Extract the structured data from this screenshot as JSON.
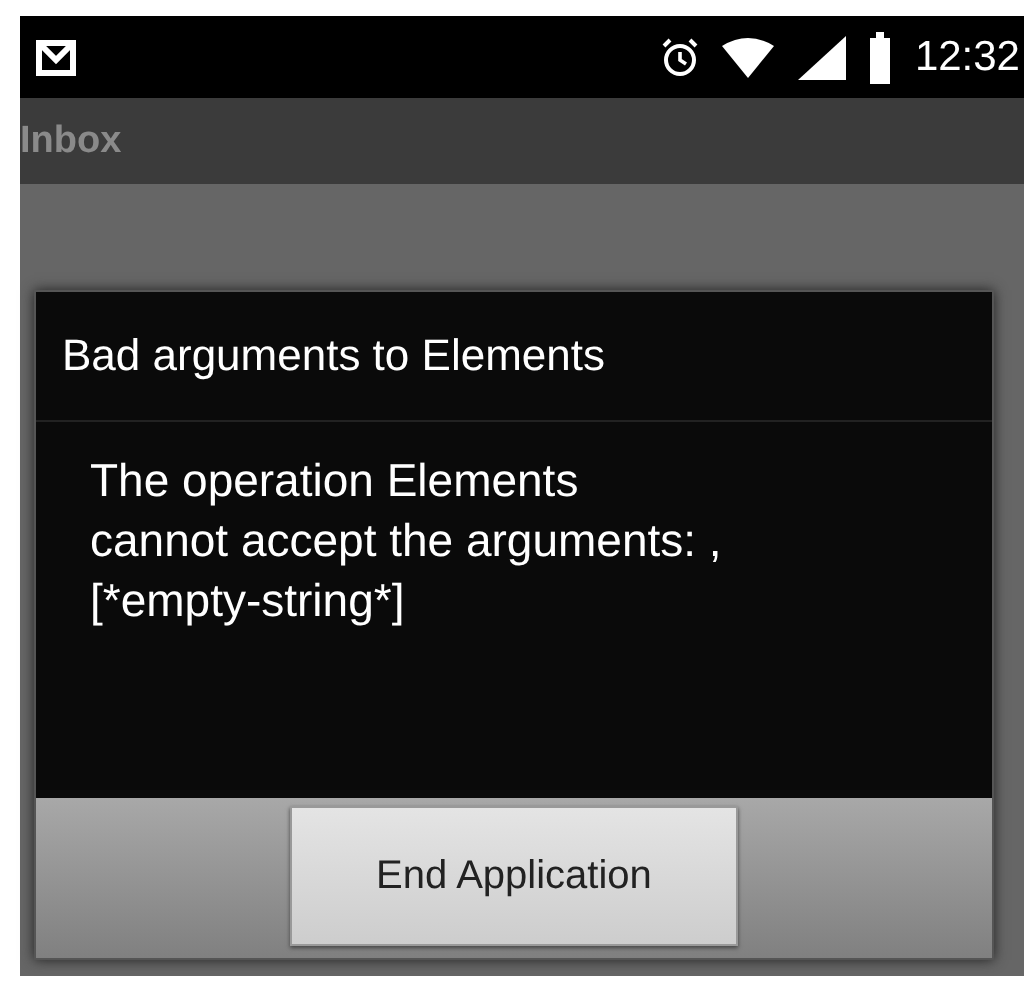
{
  "status_bar": {
    "time": "12:32"
  },
  "app_bar": {
    "title": "Inbox"
  },
  "dialog": {
    "title": "Bad arguments to Elements",
    "message": "The operation Elements\ncannot accept the arguments: ,\n[*empty-string*]",
    "buttons": [
      "End Application"
    ]
  }
}
